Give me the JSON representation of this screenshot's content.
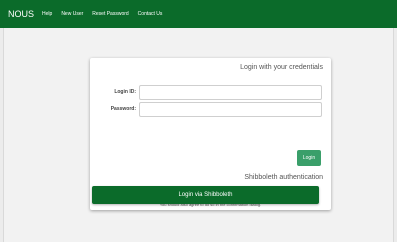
{
  "navbar": {
    "brand": "NOUS",
    "links": [
      "Help",
      "New User",
      "Reset Password",
      "Contact Us"
    ]
  },
  "login": {
    "heading": "Login with your credentials",
    "login_id_label": "Login ID:",
    "password_label": "Password:",
    "login_id_value": "",
    "password_value": "",
    "button_label": "Login"
  },
  "shibboleth": {
    "heading": "Shibboleth authentication",
    "info_line1": "For your single sign-on to NOUS, your institutional identification provider (IdP) must",
    "info_line2": "allow the 'eduPersonTargetedId' attribute to be referred by the NOUS service provider (SP).",
    "info_line3": "You should also agree to do so in the confirmation dialog.",
    "button_label": "Login via Shibboleth"
  },
  "colors": {
    "navbar_bg": "#0b6b2a",
    "login_button": "#3a9f6a",
    "shibboleth_button": "#0b6b2a"
  }
}
